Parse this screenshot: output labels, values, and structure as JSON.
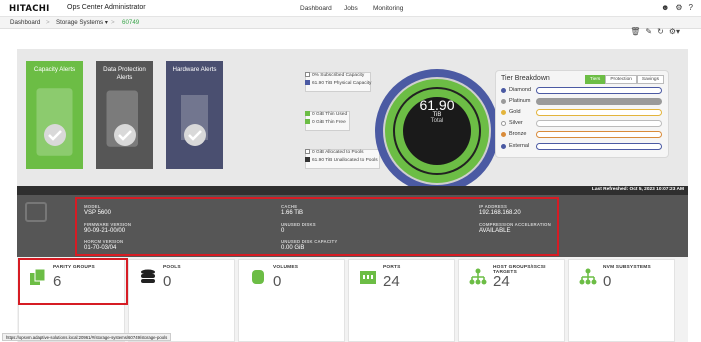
{
  "header": {
    "logo": "HITACHI",
    "app_title": "Ops Center Administrator",
    "nav": [
      "Dashboard",
      "Jobs",
      "Monitoring"
    ],
    "icons": [
      "user-icon",
      "gear-icon",
      "help-icon"
    ]
  },
  "breadcrumb": {
    "items": [
      "Dashboard",
      "Storage Systems ▾",
      "60749"
    ],
    "separator": ">"
  },
  "toolbar": {
    "icons": [
      "trash-icon",
      "edit-icon",
      "refresh-icon",
      "settings-icon"
    ]
  },
  "alerts": {
    "capacity": "Capacity Alerts",
    "data_protection": "Data Protection Alerts",
    "hardware": "Hardware Alerts"
  },
  "capacity_legend": {
    "subscribed": "0% Subscribed Capacity",
    "physical": "61.90 TiB Physical Capacity",
    "thin_used": "0 GiB Thin Used",
    "thin_free": "0 GiB Thin Free",
    "allocated_pools": "0 GiB Allocated to Pools",
    "unallocated_pools": "61.90 TiB Unallocated to Pools"
  },
  "donut": {
    "value": "61.90",
    "unit": "TiB",
    "label": "Total"
  },
  "tier_breakdown": {
    "title": "Tier Breakdown",
    "tabs": [
      "Tiers",
      "Protection",
      "Savings"
    ],
    "active_tab": "Tiers",
    "tiers": [
      {
        "name": "Diamond",
        "color": "#4b5aa3"
      },
      {
        "name": "Platinum",
        "color": "#9a9a9a"
      },
      {
        "name": "Gold",
        "color": "#e3b43c"
      },
      {
        "name": "Silver",
        "color": "#c8c8c8"
      },
      {
        "name": "Bronze",
        "color": "#d98b3a"
      },
      {
        "name": "External",
        "color": "#4b5aa3"
      }
    ]
  },
  "system_info": {
    "last_refreshed": "Last Refreshed: Oct 5, 2023 10:07:23 AM",
    "model_label": "MODEL",
    "model": "VSP 5600",
    "firmware_label": "FIRMWARE VERSION",
    "firmware": "90-09-21-00/00",
    "horcm_label": "HORCM VERSION",
    "horcm": "01-70-03/04",
    "cache_label": "CACHE",
    "cache": "1.66 TiB",
    "unused_disks_label": "UNUSED DISKS",
    "unused_disks": "0",
    "unused_disk_capacity_label": "UNUSED DISK CAPACITY",
    "unused_disk_capacity": "0.00 GiB",
    "ip_label": "IP ADDRESS",
    "ip": "192.168.168.20",
    "compression_label": "COMPRESSION ACCELERATION",
    "compression": "AVAILABLE"
  },
  "tiles": [
    {
      "label": "PARITY GROUPS",
      "value": "6"
    },
    {
      "label": "POOLS",
      "value": "0"
    },
    {
      "label": "VOLUMES",
      "value": "0"
    },
    {
      "label": "PORTS",
      "value": "24"
    },
    {
      "label": "HOST GROUPS/ISCSI TARGETS",
      "value": "24"
    },
    {
      "label": "NVM SUBSYSTEMS",
      "value": "0"
    }
  ],
  "status_url": "https://opsvm.adaptive-solutions.local:20961/#/storage-systems/60749/storage-pools"
}
